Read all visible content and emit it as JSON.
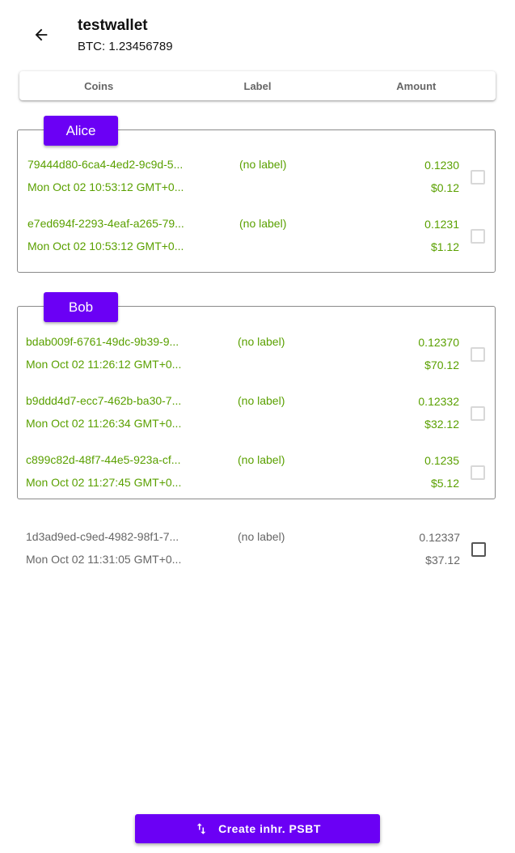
{
  "header": {
    "back_icon": "arrow-left-icon",
    "title": "testwallet",
    "balance": "BTC: 1.23456789"
  },
  "tabs": [
    {
      "label": "Coins"
    },
    {
      "label": "Label"
    },
    {
      "label": "Amount"
    }
  ],
  "groups": [
    {
      "name": "Alice",
      "coins": [
        {
          "id": "79444d80-6ca4-4ed2-9c9d-5...",
          "label": "(no label)",
          "amount": "0.1230",
          "date": "Mon Oct 02 10:53:12 GMT+0...",
          "fiat": "$0.12"
        },
        {
          "id": "e7ed694f-2293-4eaf-a265-79...",
          "label": "(no label)",
          "amount": "0.1231",
          "date": "Mon Oct 02 10:53:12 GMT+0...",
          "fiat": "$1.12"
        }
      ]
    },
    {
      "name": "Bob",
      "coins": [
        {
          "id": "bdab009f-6761-49dc-9b39-9...",
          "label": "(no label)",
          "amount": "0.12370",
          "date": "Mon Oct 02 11:26:12 GMT+0...",
          "fiat": "$70.12"
        },
        {
          "id": "b9ddd4d7-ecc7-462b-ba30-7...",
          "label": "(no label)",
          "amount": "0.12332",
          "date": "Mon Oct 02 11:26:34 GMT+0...",
          "fiat": "$32.12"
        },
        {
          "id": "c899c82d-48f7-44e5-923a-cf...",
          "label": "(no label)",
          "amount": "0.1235",
          "date": "Mon Oct 02 11:27:45 GMT+0...",
          "fiat": "$5.12"
        }
      ]
    }
  ],
  "ungrouped": [
    {
      "id": "1d3ad9ed-c9ed-4982-98f1-7...",
      "label": "(no label)",
      "amount": "0.12337",
      "date": "Mon Oct 02 11:31:05 GMT+0...",
      "fiat": "$37.12"
    }
  ],
  "action": {
    "label": "Create inhr. PSBT",
    "icon": "swap-vertical-icon"
  },
  "colors": {
    "accent": "#6b00f5",
    "grouped_text": "#5aa000",
    "ungrouped_text": "#666666"
  }
}
